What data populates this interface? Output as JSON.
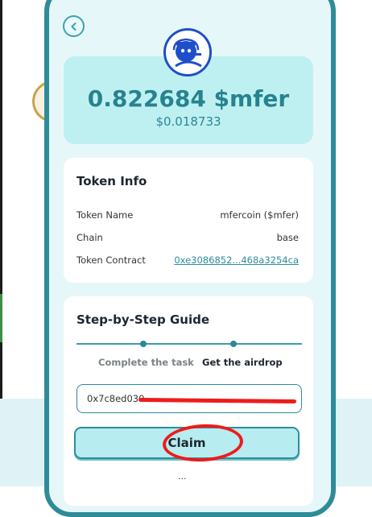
{
  "token": {
    "amount": "0.822684 $mfer",
    "usd_value": "$0.018733"
  },
  "token_info": {
    "title": "Token Info",
    "rows": [
      {
        "label": "Token Name",
        "value": "mfercoin ($mfer)"
      },
      {
        "label": "Chain",
        "value": "base"
      },
      {
        "label": "Token Contract",
        "value": "0xe3086852...468a3254ca"
      }
    ]
  },
  "guide": {
    "title": "Step-by-Step Guide",
    "steps": [
      "Complete the task",
      "Get the airdrop"
    ],
    "active_step": 2,
    "address_value": "0x7c8ed030",
    "claim_label": "Claim",
    "bottom_fragment": "..."
  },
  "colors": {
    "accent": "#2f8b98",
    "card_bg": "#bff0f1",
    "annotation_red": "#ee1c1c"
  },
  "icons": {
    "back": "chevron-left-icon",
    "logo": "mfer-logo-icon"
  }
}
